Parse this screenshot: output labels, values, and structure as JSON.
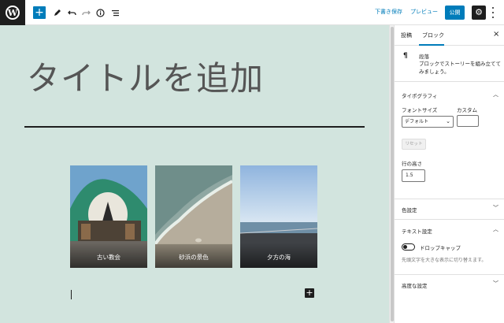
{
  "toolbar": {
    "logo_icon": "wordpress-logo",
    "add_icon": "+",
    "save_draft": "下書き保存",
    "preview": "プレビュー",
    "publish": "公開",
    "settings_icon": "gear-icon"
  },
  "editor": {
    "title": "タイトルを追加",
    "gallery": [
      {
        "caption": "古い教会"
      },
      {
        "caption": "砂浜の景色"
      },
      {
        "caption": "夕方の海"
      }
    ]
  },
  "sidebar": {
    "tabs": [
      "投稿",
      "ブロック"
    ],
    "block": {
      "icon": "¶",
      "title": "段落",
      "description": "ブロックでストーリーを組み立ててみましょう。"
    },
    "typography": {
      "heading": "タイポグラフィ",
      "font_size_label": "フォントサイズ",
      "font_size_value": "デフォルト",
      "custom_label": "カスタム",
      "reset": "リセット",
      "line_height_label": "行の高さ",
      "line_height_value": "1.5"
    },
    "color_heading": "色設定",
    "text_settings": {
      "heading": "テキスト設定",
      "drop_cap_label": "ドロップキャップ",
      "help": "先頭文字を大きな表示に切り替えます。"
    },
    "advanced_heading": "高度な設定"
  },
  "colors": {
    "accent": "#007cba",
    "canvas_bg": "#d2e4de"
  }
}
